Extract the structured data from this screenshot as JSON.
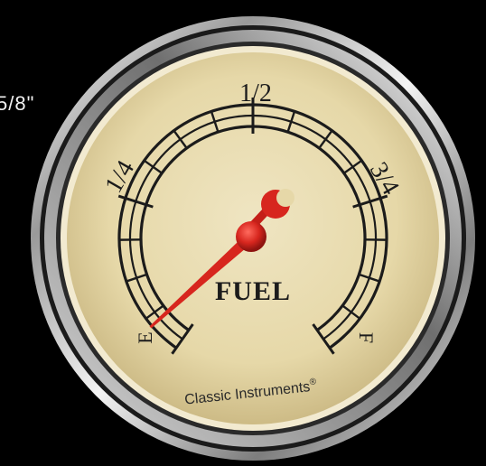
{
  "size_label": "5/8\"",
  "gauge": {
    "label": "FUEL",
    "brand": "Classic Instruments",
    "brand_mark": "®",
    "tick_labels": [
      "1/4",
      "1/2",
      "3/4"
    ],
    "empty_mark": "E",
    "full_mark": "F",
    "needle_level": 0.0,
    "colors": {
      "face": "#e8dcb0",
      "bezel": "#c9c9c9",
      "needle": "#d7261e",
      "ink": "#1b1b1b"
    }
  }
}
